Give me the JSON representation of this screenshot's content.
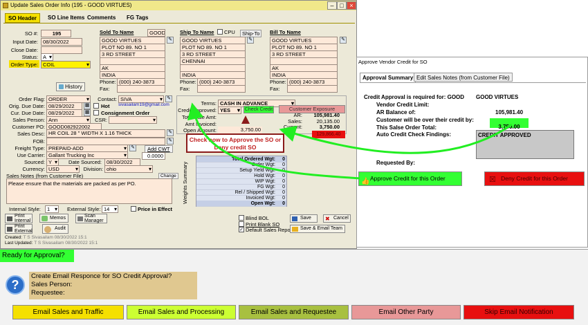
{
  "window": {
    "title": "Update Sales Order Info  (195 - GOOD VIRTUES)"
  },
  "tabs": [
    "SO Header",
    "SO Line Items",
    "Comments",
    "FG Tags"
  ],
  "header": {
    "so_label": "SO #:",
    "so_value": "195",
    "input_date_label": "Input Date:",
    "input_date": "08/30/2022",
    "close_date_label": "Close Date:",
    "close_date": "",
    "status_label": "Status:",
    "status": "A",
    "order_type_label": "Order Type:",
    "order_type": "COIL",
    "history_button": "History"
  },
  "sold_to": {
    "title": "Sold To Name",
    "tag": "GOOD",
    "name": "GOOD VIRTUES",
    "addr1": "PLOT NO 89. NO 1",
    "addr2": "3 RD STREET",
    "addr3": "",
    "city": "AK",
    "country": "INDIA",
    "phone_label": "Phone:",
    "phone": "(000) 240-3873",
    "fax_label": "Fax:",
    "fax": ""
  },
  "ship_to": {
    "title": "Ship To Name",
    "cpu_label": "CPU",
    "ship_label": "Ship-To",
    "name": "GOOD VIRTUES",
    "addr1": "PLOT NO 89. NO 1",
    "addr2": "3 RD STREET",
    "addr3": "CHENNAI",
    "city": "",
    "country": "INDIA",
    "phone_label": "Phone:",
    "phone": "(000) 240-3873",
    "fax_label": "Fax:",
    "fax": ""
  },
  "bill_to": {
    "title": "Bill To Name",
    "name": "GOOD VIRTUES",
    "addr1": "PLOT NO 89. NO 1",
    "addr2": "3 RD STREET",
    "addr3": "",
    "city": "AK",
    "country": "INDIA",
    "phone_label": "Phone:",
    "phone": "(000) 240-3873",
    "fax_label": "Fax:",
    "fax": ""
  },
  "order": {
    "order_flag_label": "Order Flag:",
    "order_flag": "ORDER",
    "orig_due_label": "Orig. Due Date:",
    "orig_due": "08/29/2022",
    "cur_due_label": "Cur. Due Date:",
    "cur_due": "08/29/2022",
    "sales_person_label": "Sales Person:",
    "sales_person": "Ann",
    "csr_label": "CSR:",
    "csr": "",
    "customer_po_label": "Customer PO:",
    "customer_po": "GOOD082922002",
    "sales_desc_label": "Sales Desc:",
    "sales_desc": "HR COIL 28 \" WIDTH X 1.16 THICK",
    "fob_label": "FOB:",
    "fob": "",
    "freight_label": "Freight Type:",
    "freight": "PREPAID-ADD",
    "carrier_label": "Use Carrier:",
    "carrier": "Gallant Trucking Inc",
    "sourced_label": "Sourced:",
    "sourced": "Y",
    "date_sourced_label": "Date Sourced:",
    "date_sourced": "08/30/2022",
    "currency_label": "Currency:",
    "currency": "USD",
    "division_label": "Division:",
    "division": "ohio",
    "add_cwt_label": "Add CWT",
    "add_cwt": "0.0000",
    "contact_label": "Contact:",
    "contact": "SIVA",
    "email": "sivasailam19@gmail.com",
    "hot_label": "Hot",
    "consignment_label": "Consignment Order",
    "sales_notes_label": "Sales Notes (from Customer File)",
    "change_label": "Change",
    "sales_notes": "Please ensure that the  materials are packed as per PO.",
    "internal_style_label": "Internal Style:",
    "internal_style": "1",
    "external_style_label": "External Style:",
    "external_style": "14",
    "price_in_effect": "Price in Effect"
  },
  "terms": {
    "terms_label": "Terms:",
    "terms": "CASH IN ADVANCE",
    "credit_approved_label": "Credit Approved:",
    "credit_approved": "YES",
    "check_credit": "Check Credit",
    "customer_exposure": "Customer Exposure",
    "total_sale_label": "Total Sale Amt:",
    "amt_invoiced_label": "Amt Invoiced:",
    "open_amount_label": "Open Amount:",
    "open_amount": "3,750.00",
    "ar_label": "AR:",
    "ar": "105,981.40",
    "sales_label": "Sales:",
    "sales": "20,135.00",
    "current_label": "Current:",
    "current": "3,750.00",
    "over_credit": "129,866.40"
  },
  "callout": "Check now to Approve the SO or Deny credit SO",
  "weights": {
    "title": "Weights Summary",
    "rows": [
      {
        "label": "Total Ordered Wgt:",
        "value": "0"
      },
      {
        "label": "Order Wgt:",
        "value": "0"
      },
      {
        "label": "Setup Yield Wgt:",
        "value": "0"
      },
      {
        "label": "Hold Wgt:",
        "value": "0"
      },
      {
        "label": "WIP Wgt:",
        "value": "0"
      },
      {
        "label": "FG Wgt:",
        "value": "0"
      },
      {
        "label": "Rel / Shipped Wgt:",
        "value": "0"
      },
      {
        "label": "Invoiced Wgt:",
        "value": "0"
      },
      {
        "label": "Open Wgt:",
        "value": "0"
      }
    ]
  },
  "options": {
    "blind_bol": "Blind BOL",
    "print_blank": "Print Blank SO",
    "default_report": "Default Sales Report",
    "save": "Save",
    "cancel": "Cancel",
    "save_email": "Save & Email Team"
  },
  "bottom_buttons": {
    "print_internal": "Print Internal",
    "print_external": "Print External",
    "memos": "Memos",
    "audit": "Audit",
    "scan_manager": "Scan Manager"
  },
  "footer": {
    "created_label": "Created:",
    "created": "T S Sivasailam 08/30/2022 15:1",
    "updated_label": "Last Updated:",
    "updated": "T S Sivasailam 08/30/2022 15:1"
  },
  "approve_panel": {
    "title": "Approve Vendor Credit for SO",
    "tab1": "Approval Summary",
    "tab2": "Edit Sales Notes (from Customer File)",
    "required_label": "Credit Approval is required for: GOOD",
    "customer": "GOOD VIRTUES",
    "limit_label": "Vendor Credit Limit:",
    "limit": "",
    "ar_label": "AR Balance of:",
    "ar_value": "105,981.40",
    "over_label": "Customer will be over their credit by:",
    "over_value": "",
    "total_label": "This Salse Order Total:",
    "total_value": "3,750.00",
    "auto_label": "Auto Credit Check Findings:",
    "auto_value": "CREDIT APPROVED",
    "requested_label": "Requested By:",
    "approve_btn": "Approve Credit for this Order",
    "deny_btn": "Deny Credit for this Order"
  },
  "ready_banner": "Ready for Approval?",
  "email": {
    "q1": "Create Email Responce for SO Credit Approval?",
    "q2": "Sales Person:",
    "q3": "Requestee:"
  },
  "email_buttons": [
    "Email Sales and Traffic",
    "Email Sales and Processing",
    "Email Sales and Requestee",
    "Email Other Party",
    "Skip Email Notification"
  ],
  "colors": {
    "yellow": "#f5e000",
    "lime": "#33ff33",
    "red": "#e81010",
    "pink": "#fde9d9",
    "khaki": "#e0c890",
    "olive": "#a8c040",
    "rose": "#e89898"
  }
}
